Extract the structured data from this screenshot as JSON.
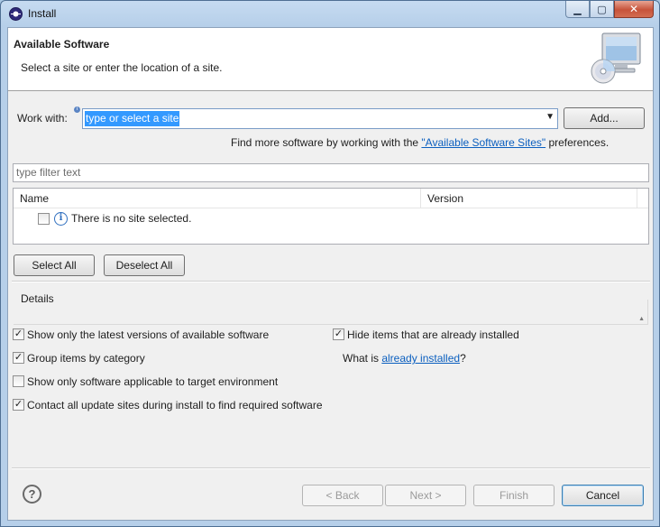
{
  "window": {
    "title": "Install",
    "min_glyph": "▁",
    "max_glyph": "▢",
    "close_glyph": "✕"
  },
  "banner": {
    "title": "Available Software",
    "description": "Select a site or enter the location of a site.",
    "icon": "monitor-cd-icon"
  },
  "work_with": {
    "label": "Work with:",
    "placeholder": "type or select a site",
    "add_button": "Add...",
    "hint_prefix": "Find more software by working with the ",
    "hint_link": "\"Available Software Sites\"",
    "hint_suffix": " preferences."
  },
  "filter": {
    "placeholder": "type filter text"
  },
  "table": {
    "columns": [
      "Name",
      "Version"
    ],
    "rows": [
      {
        "text": "There is no site selected.",
        "checked": false,
        "icon": "info-icon"
      }
    ]
  },
  "selection": {
    "select_all": "Select All",
    "deselect_all": "Deselect All"
  },
  "details": {
    "label": "Details"
  },
  "options": {
    "latest_versions": {
      "label": "Show only the latest versions of available software",
      "checked": true
    },
    "hide_installed": {
      "label": "Hide items that are already installed",
      "checked": true
    },
    "group_by_category": {
      "label": "Group items by category",
      "checked": true
    },
    "target_env": {
      "label": "Show only software applicable to target environment",
      "checked": false
    },
    "contact_sites": {
      "label": "Contact all update sites during install to find required software",
      "checked": true
    },
    "what_is_prefix": "What is ",
    "what_is_link": "already installed",
    "what_is_suffix": "?"
  },
  "footer": {
    "back": "< Back",
    "next": "Next >",
    "finish": "Finish",
    "cancel": "Cancel",
    "check_glyph": "✓"
  },
  "colors": {
    "selection": "#3399ff",
    "link": "#0b5fbf",
    "titlebar": "#c6dbf1"
  }
}
